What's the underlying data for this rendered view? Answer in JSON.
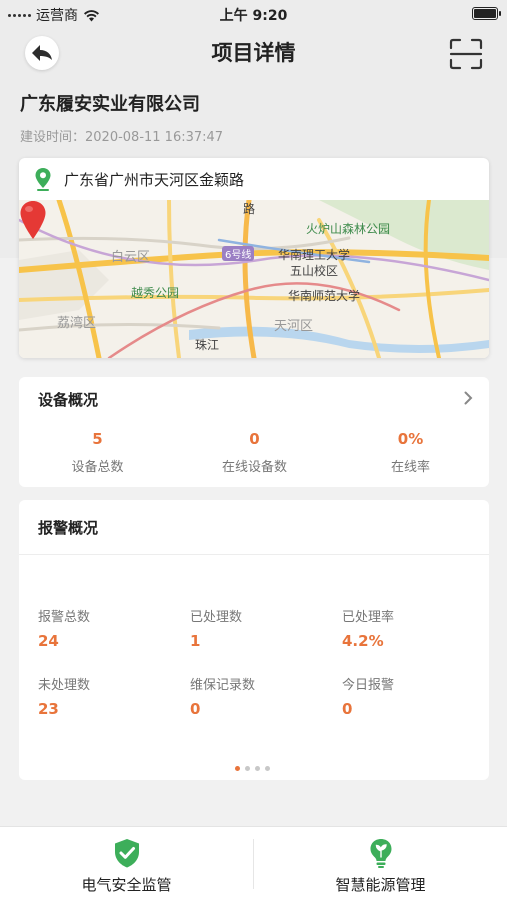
{
  "status_bar": {
    "carrier": "运营商",
    "time": "上午 9:20"
  },
  "nav": {
    "title": "项目详情"
  },
  "project": {
    "company": "广东履安实业有限公司",
    "build_time": "建设时间：2020-08-11 16:37:47"
  },
  "map": {
    "address": "广东省广州市天河区金颖路",
    "labels": {
      "baiyun": "白云区",
      "tianhe": "天河区",
      "liwan": "荔湾区",
      "zhujiang": "珠江",
      "yuexiu_park": "越秀公园",
      "huolushan": "火炉山森林公园",
      "scut": "华南理工大学",
      "wushan": "五山校区",
      "scnu": "华南师范大学",
      "metro6": "6号线",
      "road": "路"
    }
  },
  "devices": {
    "title": "设备概况",
    "stats": [
      {
        "value": "5",
        "label": "设备总数"
      },
      {
        "value": "0",
        "label": "在线设备数"
      },
      {
        "value": "0%",
        "label": "在线率"
      }
    ]
  },
  "alarms": {
    "title": "报警概况",
    "stats": [
      {
        "label": "报警总数",
        "value": "24"
      },
      {
        "label": "已处理数",
        "value": "1"
      },
      {
        "label": "已处理率",
        "value": "4.2%"
      },
      {
        "label": "未处理数",
        "value": "23"
      },
      {
        "label": "维保记录数",
        "value": "0"
      },
      {
        "label": "今日报警",
        "value": "0"
      }
    ]
  },
  "tabs": [
    {
      "label": "电气安全监管",
      "icon": "shield-check-icon",
      "color": "#3dae5a"
    },
    {
      "label": "智慧能源管理",
      "icon": "bulb-leaf-icon",
      "color": "#3dae5a"
    }
  ],
  "colors": {
    "accent": "#e8743b",
    "green": "#3dae5a"
  }
}
